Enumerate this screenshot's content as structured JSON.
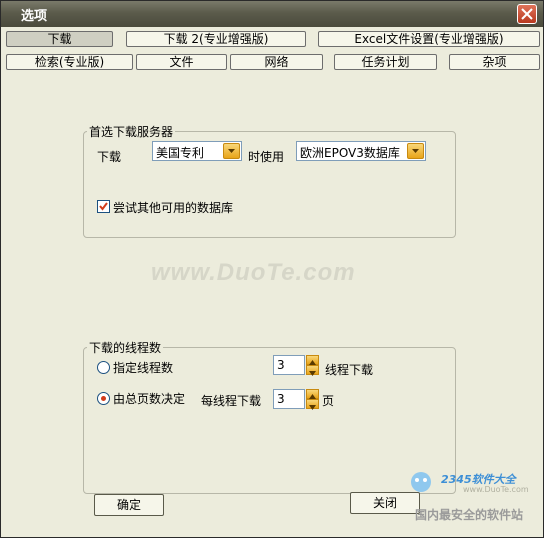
{
  "window": {
    "title": "选项"
  },
  "tabs_row1": [
    {
      "label": "下载",
      "active": true
    },
    {
      "label": "下载 2(专业增强版)",
      "active": false
    },
    {
      "label": "Excel文件设置(专业增强版)",
      "active": false
    }
  ],
  "tabs_row2": [
    {
      "label": "检索(专业版)"
    },
    {
      "label": "文件"
    },
    {
      "label": "网络"
    },
    {
      "label": "任务计划"
    },
    {
      "label": "杂项"
    }
  ],
  "server_group": {
    "title": "首选下载服务器",
    "download_label": "下载",
    "download_source": "美国专利",
    "use_label": "时使用",
    "database": "欧洲EPOV3数据库",
    "try_other_label": "尝试其他可用的数据库",
    "try_other_checked": true
  },
  "thread_group": {
    "title": "下载的线程数",
    "option_fixed_label": "指定线程数",
    "option_fixed_selected": false,
    "thread_count": "3",
    "thread_suffix": "线程下载",
    "option_pages_label": "由总页数决定",
    "option_pages_selected": true,
    "per_thread_label": "每线程下载",
    "pages_per_thread": "3",
    "pages_suffix": "页"
  },
  "buttons": {
    "ok": "确定",
    "close": "关闭"
  },
  "watermark": {
    "text": "www.DuoTe.com"
  },
  "logo": {
    "brand": "2345软件大全",
    "url": "www.DuoTe.com",
    "slogan": "国内最安全的软件站"
  },
  "colors": {
    "titlebar": "#5b5b4b",
    "window_bg": "#ececdc",
    "accent_button": "#e8a419",
    "radio_dot": "#d23c1a"
  }
}
